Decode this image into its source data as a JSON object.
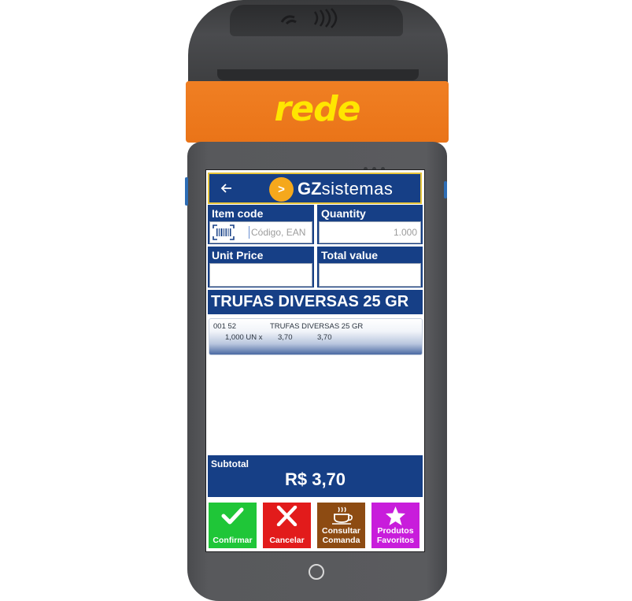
{
  "device": {
    "brand": "rede"
  },
  "app": {
    "logo_initials": ">",
    "logo_brand_bold": "GZ",
    "logo_brand_rest": "sistemas",
    "back_label": "←"
  },
  "form": {
    "item_code": {
      "label": "Item code",
      "placeholder": "Código, EAN",
      "value": ""
    },
    "quantity": {
      "label": "Quantity",
      "value": "1.000"
    },
    "unit_price": {
      "label": "Unit Price",
      "value": ""
    },
    "total_value": {
      "label": "Total value",
      "value": ""
    }
  },
  "product_name": "TRUFAS DIVERSAS 25 GR",
  "items": [
    {
      "code": "001 52",
      "description": "TRUFAS DIVERSAS 25 GR",
      "qty": "1,000 UN x",
      "unit_price": "3,70",
      "total": "3,70"
    }
  ],
  "subtotal": {
    "label": "Subtotal",
    "value": "R$ 3,70"
  },
  "actions": {
    "confirm": "Confirmar",
    "cancel": "Cancelar",
    "consult_line1": "Consultar",
    "consult_line2": "Comanda",
    "fav_line1": "Produtos",
    "fav_line2": "Favoritos"
  },
  "colors": {
    "header_blue": "#163f86",
    "accent_yellow": "#e7c53b",
    "device_orange": "#f07f23",
    "confirm_green": "#1fc638",
    "cancel_red": "#e21b1b",
    "consult_brown": "#8d4b12",
    "fav_purple": "#c81ddb"
  },
  "icons": {
    "back": "arrow-left-icon",
    "barcode": "barcode-scan-icon",
    "confirm": "check-icon",
    "cancel": "close-icon",
    "consult": "coffee-cup-icon",
    "favorites": "star-icon",
    "nfc": "contactless-icon"
  }
}
